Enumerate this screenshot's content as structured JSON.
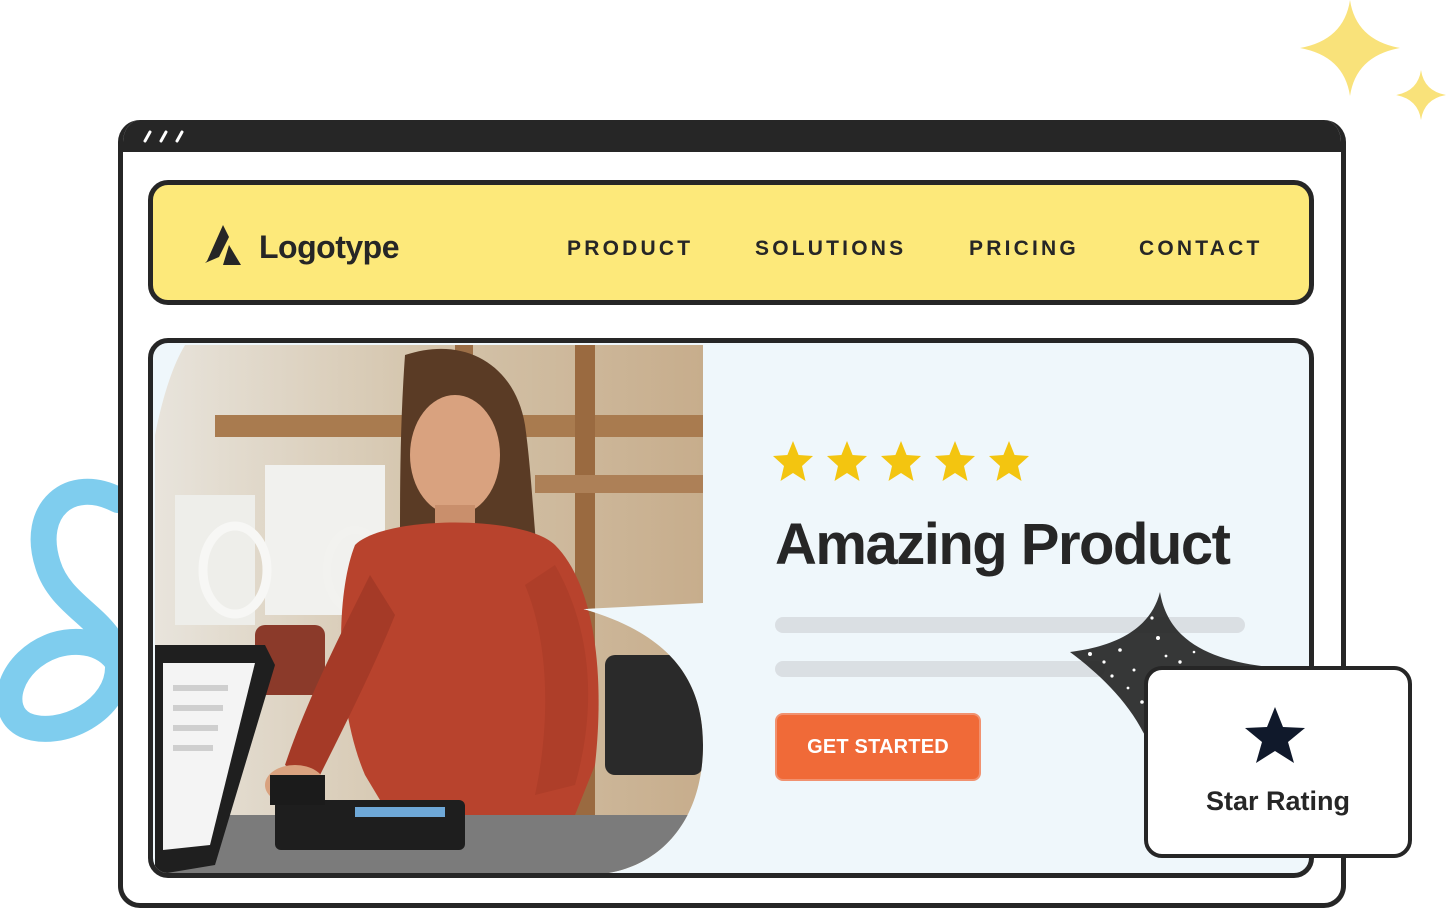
{
  "brand": {
    "name": "Logotype"
  },
  "nav": {
    "items": [
      {
        "label": "PRODUCT"
      },
      {
        "label": "SOLUTIONS"
      },
      {
        "label": "PRICING"
      },
      {
        "label": "CONTACT"
      }
    ]
  },
  "hero": {
    "rating_stars": 5,
    "title": "Amazing Product",
    "cta_label": "GET STARTED"
  },
  "badge": {
    "label": "Star Rating"
  },
  "colors": {
    "nav_bg": "#fde97a",
    "hero_bg": "#eff7fb",
    "cta": "#f06a38",
    "star": "#f3c510",
    "sparkle": "#f9e27a",
    "swirl": "#7fcdee",
    "frame": "#262626"
  },
  "icons": {
    "logo": "logo-mark-icon",
    "rating_star": "star-icon",
    "badge_star": "star-icon",
    "sparkle": "sparkle-icon"
  }
}
